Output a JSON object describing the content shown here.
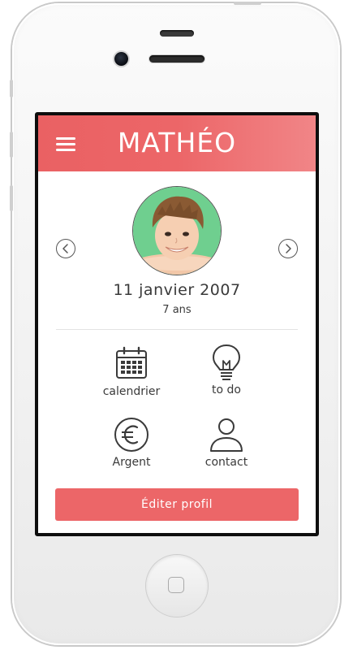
{
  "header": {
    "title": "MATHÉO",
    "menu_icon": "hamburger-menu-icon"
  },
  "profile": {
    "birthdate": "11 janvier 2007",
    "age": "7 ans"
  },
  "tiles": [
    {
      "label": "calendrier",
      "icon": "calendar-icon"
    },
    {
      "label": "to do",
      "icon": "lightbulb-icon"
    },
    {
      "label": "Argent",
      "icon": "euro-icon"
    },
    {
      "label": "contact",
      "icon": "person-icon"
    }
  ],
  "actions": {
    "edit_profile_label": "Éditer profil"
  },
  "colors": {
    "accent": "#ec6668",
    "header_gradient_end": "#f18587",
    "avatar_background": "#6fcf8f",
    "text": "#3a3a3a"
  }
}
